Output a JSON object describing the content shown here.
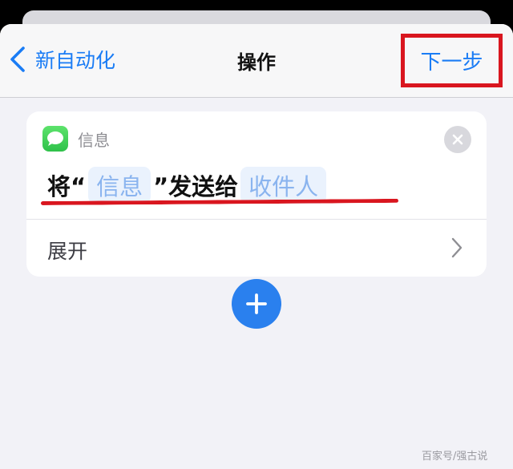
{
  "nav": {
    "back_label": "新自动化",
    "title": "操作",
    "next_label": "下一步"
  },
  "card": {
    "app_name": "信息",
    "action": {
      "prefix": "将“",
      "token_message": "信息",
      "middle": "”发送给",
      "token_recipient": "收件人"
    },
    "expand_label": "展开"
  },
  "watermark": "百家号/强古说",
  "colors": {
    "accent": "#1a7cf5",
    "highlight_annotation": "#d9161f",
    "add_button": "#2a80ee",
    "messages_icon": "#34c759"
  },
  "icons": {
    "back": "chevron-left-icon",
    "app": "messages-icon",
    "close": "close-icon",
    "expand": "chevron-right-icon",
    "add": "plus-icon"
  }
}
